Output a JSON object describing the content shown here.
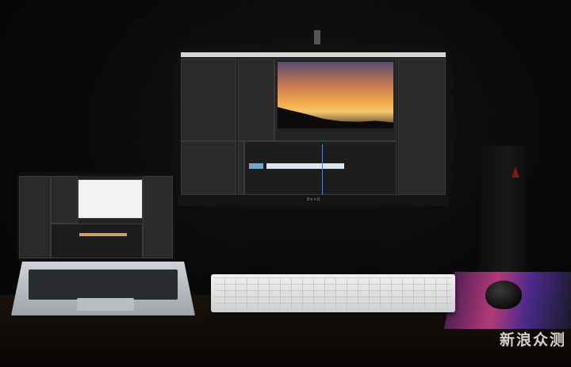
{
  "monitor": {
    "brand_text": "BenQ"
  },
  "watermark": {
    "text": "新浪众测"
  },
  "colors": {
    "background": "#050505",
    "premiere_panel": "#2a2a2a",
    "playhead": "#3a86ff",
    "mouse_pad_accent": "#b23a7a"
  }
}
